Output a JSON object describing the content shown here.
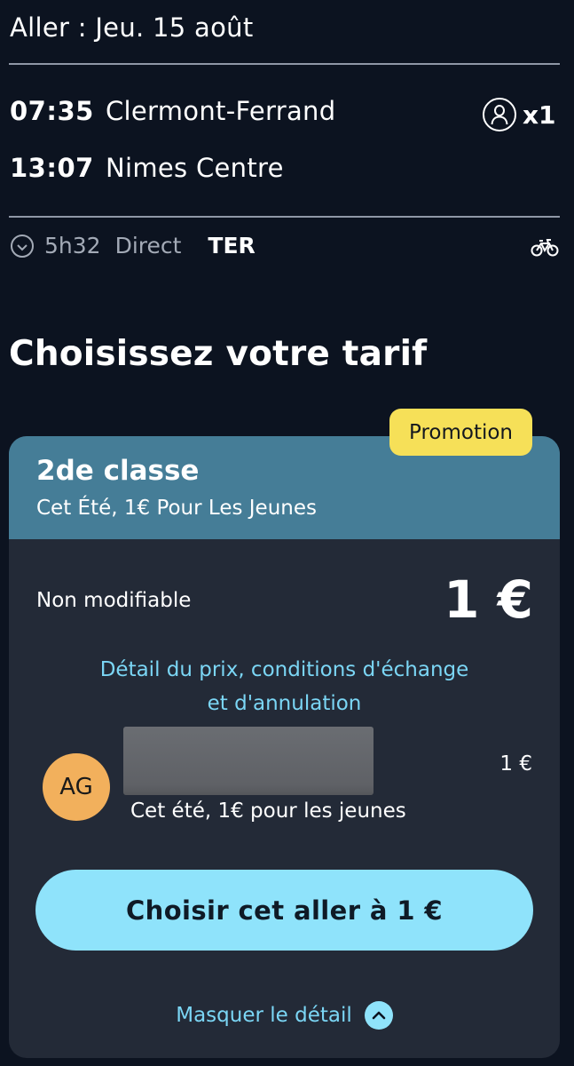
{
  "header": {
    "title": "Aller : Jeu. 15 août"
  },
  "journey": {
    "departure": {
      "time": "07:35",
      "station": "Clermont-Ferrand"
    },
    "arrival": {
      "time": "13:07",
      "station": "Nimes Centre"
    },
    "passengers": "x1",
    "duration": "5h32",
    "type": "Direct",
    "train": "TER",
    "icons": [
      "person-icon",
      "clock-icon",
      "bike-icon"
    ]
  },
  "section": {
    "title": "Choisissez votre tarif"
  },
  "fare": {
    "badge": "Promotion",
    "class_name": "2de classe",
    "fare_name": "Cet Été, 1€ Pour Les Jeunes",
    "condition": "Non modifiable",
    "price": "1 €",
    "detail_link_line1": "Détail du prix, conditions d'échange",
    "detail_link_line2": "et d'annulation",
    "passenger": {
      "initials": "AG",
      "price": "1 €",
      "fare_name": "Cet été, 1€ pour les jeunes"
    },
    "choose_button": "Choisir cet aller à 1 €",
    "hide_detail": "Masquer le détail"
  },
  "colors": {
    "background": "#0c1320",
    "card": "#232a37",
    "card_header": "#457d97",
    "badge": "#f6e058",
    "accent": "#8fe3fb",
    "link": "#7bd6f5",
    "avatar": "#f2b05c"
  }
}
